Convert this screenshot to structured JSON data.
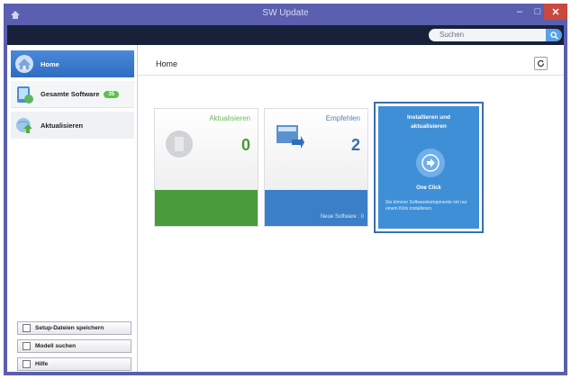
{
  "window": {
    "title": "SW Update",
    "controls": {
      "minimize": "–",
      "maximize": "□",
      "close": "✕"
    }
  },
  "search": {
    "placeholder": "Suchen"
  },
  "sidebar": {
    "items": [
      {
        "label": "Home",
        "icon": "home-icon"
      },
      {
        "label": "Gesamte Software",
        "badge": "35",
        "icon": "software-icon"
      },
      {
        "label": "Aktualisieren",
        "icon": "update-globe-icon"
      }
    ],
    "bottom_buttons": [
      {
        "label": "Setup-Dateien speichern"
      },
      {
        "label": "Modell suchen"
      },
      {
        "label": "Hilfe"
      }
    ]
  },
  "main": {
    "page_title": "Home",
    "cards": [
      {
        "title": "Aktualisieren",
        "count": "0",
        "color": "#4a9b3a"
      },
      {
        "title": "Empfehlen",
        "count": "2",
        "note": "Neue Software : 0",
        "color": "#3b7fc8"
      },
      {
        "title": "Installieren und aktualisieren",
        "one_click": "One Click",
        "description": "Sie können Softwarekomponente mit nur einem Klick installieren.",
        "color": "#3f8fd6"
      }
    ]
  }
}
